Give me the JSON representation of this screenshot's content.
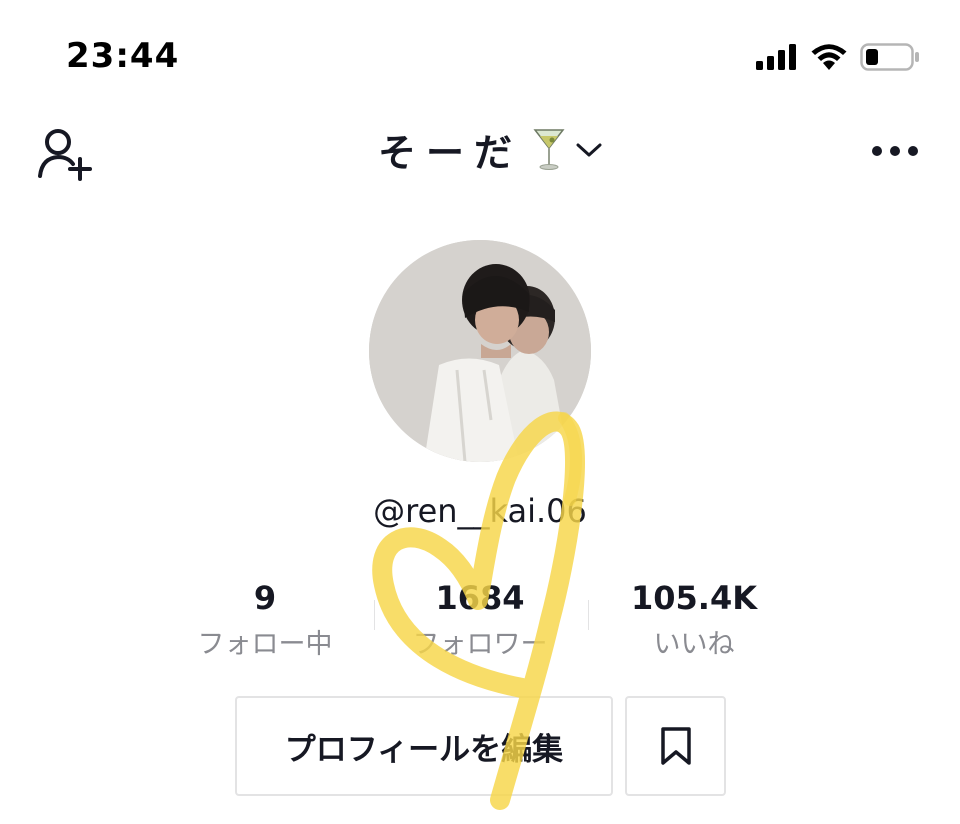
{
  "status_bar": {
    "time": "23:44",
    "signal_icon": "cellular-signal-icon",
    "wifi_icon": "wifi-icon",
    "battery_icon": "battery-low-icon"
  },
  "header": {
    "add_friend_icon": "add-user-icon",
    "title": "そーだ",
    "title_emoji": "🍸",
    "dropdown_icon": "chevron-down-icon",
    "more_icon": "more-dots-icon"
  },
  "profile": {
    "avatar_icon": "profile-photo",
    "username": "@ren__kai.06"
  },
  "stats": [
    {
      "value": "9",
      "label": "フォロー中"
    },
    {
      "value": "1684",
      "label": "フォロワー"
    },
    {
      "value": "105.4K",
      "label": "いいね"
    }
  ],
  "actions": {
    "edit_label": "プロフィールを編集",
    "bookmark_icon": "bookmark-icon"
  },
  "overlay": {
    "heart_color": "#f6d648",
    "heart_icon": "hand-drawn-heart"
  },
  "colors": {
    "text_primary": "#161823",
    "text_secondary": "#8a8b91",
    "border": "#e3e3e4"
  }
}
